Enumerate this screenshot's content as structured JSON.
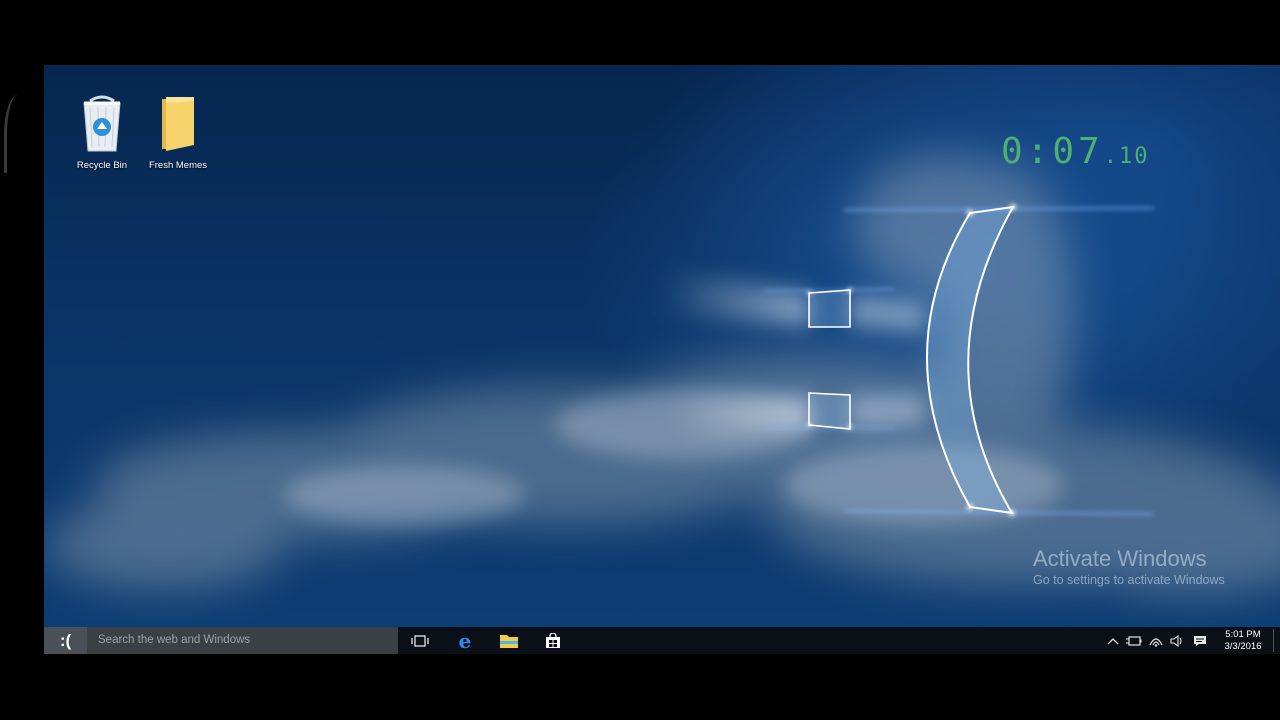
{
  "desktop": {
    "icons": [
      {
        "label": "Recycle Bin",
        "icon": "recycle-bin-icon"
      },
      {
        "label": "Fresh Memes",
        "icon": "folder-icon"
      }
    ]
  },
  "timer": {
    "main": "0:07",
    "fraction": ".10",
    "color": "#4fae72"
  },
  "watermark": {
    "title": "Activate Windows",
    "subtitle": "Go to settings to activate Windows"
  },
  "taskbar": {
    "start_label": ":(",
    "search_placeholder": "Search the web and Windows",
    "pinned": [
      "task-view-icon",
      "edge-icon",
      "file-explorer-icon",
      "store-icon"
    ],
    "tray": [
      "chevron-up-icon",
      "battery-icon",
      "wifi-icon",
      "volume-icon",
      "action-center-icon"
    ],
    "clock": {
      "time": "5:01 PM",
      "date": "3/3/2016"
    }
  },
  "colors": {
    "wallpaper": "#0a3466",
    "taskbar": "#0b0f18",
    "accent": "#4fae72"
  }
}
